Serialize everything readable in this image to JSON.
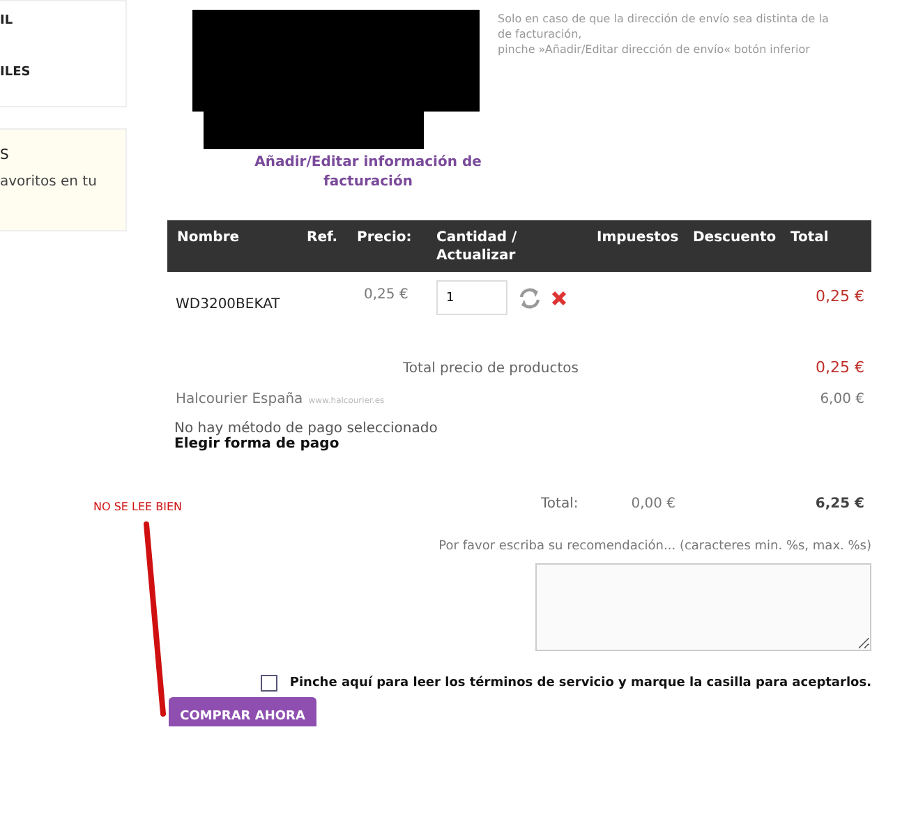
{
  "sidebar": {
    "panels": [
      {
        "kind": "plain",
        "lines": [
          {
            "kind": "heading",
            "text": "IL"
          },
          {
            "kind": "heading",
            "text": "ILES"
          }
        ]
      },
      {
        "kind": "highlight",
        "lines": [
          {
            "kind": "heading",
            "text": "S"
          },
          {
            "kind": "text",
            "text": "avoritos en tu"
          }
        ]
      }
    ]
  },
  "address": {
    "note": [
      "Solo en caso de que la dirección de envío sea distinta de la de facturación,",
      "pinche »Añadir/Editar dirección de envío« botón inferior"
    ],
    "link": "Añadir/Editar información de facturación"
  },
  "cart": {
    "columns": [
      "Nombre",
      "Ref.",
      "Precio:",
      "Cantidad / Actualizar",
      "Impuestos",
      "Descuento",
      "Total"
    ],
    "rows": [
      {
        "name": "WD3200BEKAT",
        "price": "0,25 €",
        "quantity": "1",
        "total": "0,25 €"
      }
    ]
  },
  "summary": {
    "products_label": "Total precio de productos",
    "products_total": "0,25 €",
    "shipping": {
      "name": "Halcourier España",
      "url": "www.halcourier.es",
      "price": "6,00 €"
    },
    "payment": {
      "status": "No hay método de pago seleccionado",
      "action": "Elegir forma de pago"
    },
    "total": {
      "label": "Total:",
      "tax": "0,00 €",
      "amount": "6,25 €"
    }
  },
  "recommendation": {
    "label": "Por favor escriba su recomendación... (caracteres min. %s, max. %s)"
  },
  "terms": {
    "checked": false,
    "text": "Pinche aquí para leer los términos de servicio y marque la casilla para aceptarlos."
  },
  "buy_button": "COMPRAR AHORA",
  "annotation": {
    "text": "NO SE LEE BIEN"
  }
}
